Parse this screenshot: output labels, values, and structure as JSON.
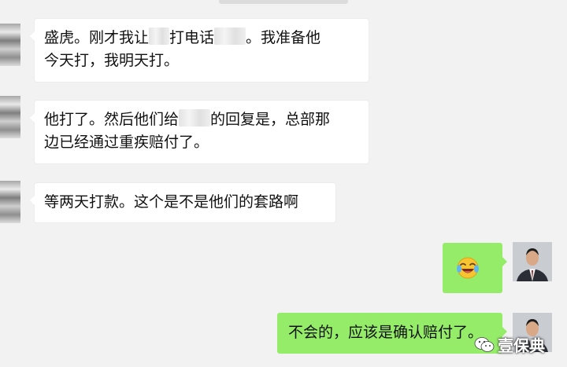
{
  "messages": [
    {
      "side": "in",
      "lines": [
        "盛虎。刚才我让[m]打电话[m]。我准备他",
        "今天打，我明天打。"
      ]
    },
    {
      "side": "in",
      "lines": [
        "他打了。然后他们给[m]的回复是，总部那",
        "边已经通过重疾赔付了。"
      ]
    },
    {
      "side": "in",
      "lines": [
        "等两天打款。这个是不是他们的套路啊"
      ]
    },
    {
      "side": "out",
      "emoji": "face-with-tears-of-joy-icon"
    },
    {
      "side": "out",
      "text": "不会的，应该是确认赔付了。"
    }
  ],
  "msg1": {
    "line1_a": "盛虎。刚才我让",
    "line1_b": "打电话",
    "line1_c": "。我准备他",
    "line2": "今天打，我明天打。"
  },
  "msg2": {
    "line1_a": "他打了。然后他们给",
    "line1_b": "的回复是，总部那",
    "line2": "边已经通过重疾赔付了。"
  },
  "msg3": {
    "text": "等两天打款。这个是不是他们的套路啊"
  },
  "msg5": {
    "text": "不会的，应该是确认赔付了。"
  },
  "watermark": {
    "text": "壹保典"
  },
  "colors": {
    "background": "#f2f2f2",
    "incoming_bubble": "#ffffff",
    "outgoing_bubble": "#95ec69"
  }
}
